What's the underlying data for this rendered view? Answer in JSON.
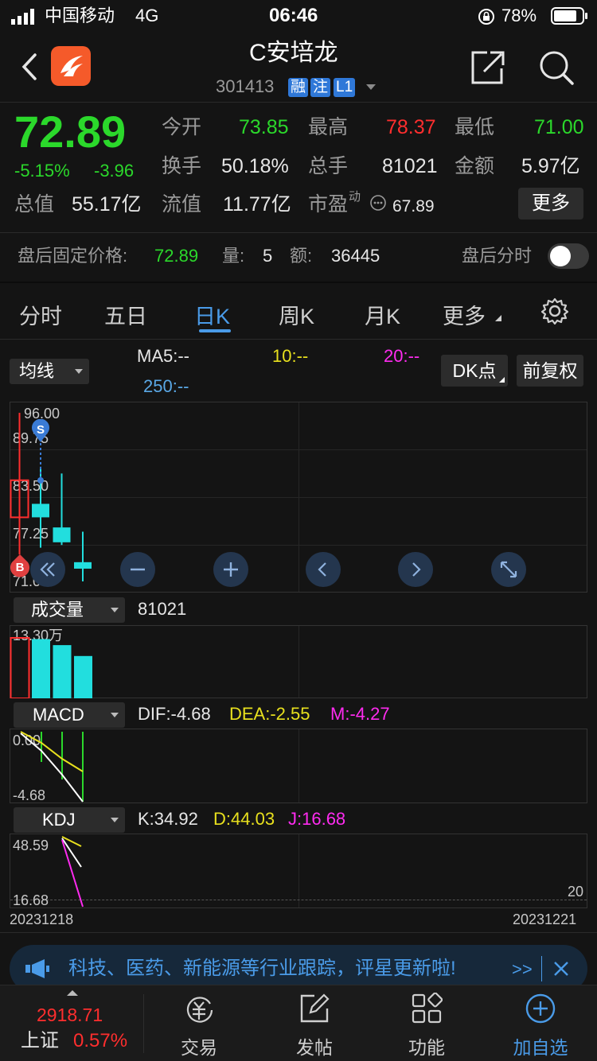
{
  "status": {
    "carrier": "中国移动",
    "network": "4G",
    "time": "06:46",
    "battery_pct": "78%"
  },
  "header": {
    "name": "C安培龙",
    "code": "301413",
    "badges": [
      "融",
      "注",
      "L1"
    ]
  },
  "quote": {
    "price": "72.89",
    "change_pct": "-5.15%",
    "change": "-3.96",
    "open_label": "今开",
    "open": "73.85",
    "high_label": "最高",
    "high": "78.37",
    "low_label": "最低",
    "low": "71.00",
    "turnover_label": "换手",
    "turnover": "50.18%",
    "vol_label": "总手",
    "vol": "81021",
    "amount_label": "金额",
    "amount": "5.97亿",
    "mktcap_label": "总值",
    "mktcap": "55.17亿",
    "float_label": "流值",
    "float": "11.77亿",
    "pe_label": "市盈",
    "pe_sup": "动",
    "pe": "67.89",
    "more_label": "更多"
  },
  "afterhours": {
    "price_label": "盘后固定价格:",
    "price": "72.89",
    "vol_label": "量:",
    "vol": "5",
    "amt_label": "额:",
    "amt": "36445",
    "timeshare_label": "盘后分时"
  },
  "tabs": [
    "分时",
    "五日",
    "日K",
    "周K",
    "月K",
    "更多"
  ],
  "active_tab": "日K",
  "ma_bar": {
    "selector": "均线",
    "ma5": "MA5:--",
    "ma10": "10:--",
    "ma20": "20:--",
    "ma250": "250:--",
    "dk_label": "DK点",
    "adjust_label": "前复权"
  },
  "kline": {
    "y_labels": [
      "96.00",
      "89.75",
      "83.50",
      "77.25",
      "71.00"
    ],
    "markers": {
      "sell": "S",
      "buy": "B"
    },
    "candles": [
      {
        "open": 86.0,
        "close": 80.5,
        "high": 96.0,
        "low": 75.0,
        "color": "red-hollow"
      },
      {
        "open": 80.5,
        "close": 82.5,
        "high": 88.0,
        "low": 76.0,
        "color": "cyan"
      },
      {
        "open": 79.0,
        "close": 76.8,
        "high": 87.0,
        "low": 76.4,
        "color": "cyan"
      },
      {
        "open": 73.85,
        "close": 72.89,
        "high": 78.37,
        "low": 71.0,
        "color": "cyan"
      }
    ]
  },
  "volume": {
    "selector": "成交量",
    "value": "81021",
    "max_label": "13.30万",
    "bars": [
      1.0,
      0.98,
      0.88,
      0.7
    ]
  },
  "macd": {
    "selector": "MACD",
    "dif": "DIF:-4.68",
    "dea": "DEA:-2.55",
    "m": "M:-4.27",
    "y_top": "0.00",
    "y_bottom": "-4.68"
  },
  "kdj": {
    "selector": "KDJ",
    "k": "K:34.92",
    "d": "D:44.03",
    "j": "J:16.68",
    "y_top": "48.59",
    "y_bottom": "16.68",
    "right_label": "20"
  },
  "dates": {
    "start": "20231218",
    "end": "20231221"
  },
  "banner": {
    "text": "科技、医药、新能源等行业跟踪，评星更新啦!",
    "more": ">>"
  },
  "bottom": {
    "index_value": "2918.71",
    "index_name": "上证",
    "index_change": "0.57%",
    "nav": [
      "交易",
      "发帖",
      "功能",
      "加自选"
    ]
  },
  "colors": {
    "up": "#ff2e2e",
    "down": "#2bd82b",
    "accent": "#4a9be8",
    "candle_down": "#22dede"
  }
}
